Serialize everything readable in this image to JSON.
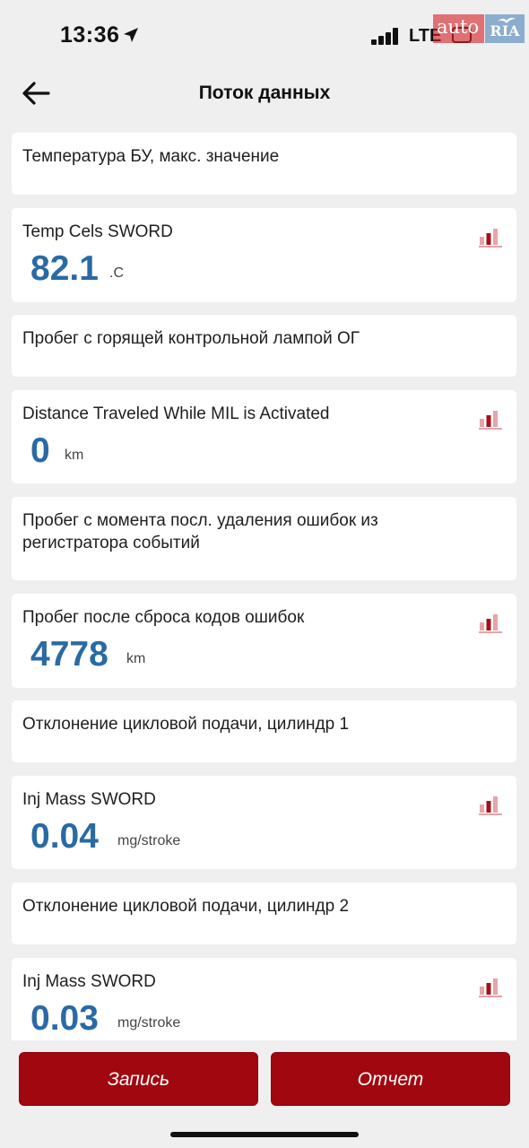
{
  "status_bar": {
    "time": "13:36",
    "network": "LTE",
    "watermark_left": "auto",
    "watermark_right": "RIA"
  },
  "header": {
    "title": "Поток данных",
    "back_icon": "arrow-left-icon"
  },
  "list": {
    "items": [
      {
        "type": "section",
        "title": "Температура БУ, макс. значение"
      },
      {
        "type": "param",
        "title": "Temp Cels SWORD",
        "value": "82.1",
        "unit": ".C",
        "icon": "graph-icon"
      },
      {
        "type": "section",
        "title": "Пробег с горящей контрольной лампой ОГ"
      },
      {
        "type": "param",
        "title": "Distance Traveled While MIL is Activated",
        "value": "0",
        "unit": "km",
        "icon": "graph-icon"
      },
      {
        "type": "section",
        "title": "Пробег с момента посл. удаления ошибок из регистратора событий"
      },
      {
        "type": "param",
        "title": "Пробег после сброса кодов ошибок",
        "value": "4778",
        "unit": "km",
        "icon": "graph-icon"
      },
      {
        "type": "section",
        "title": "Отклонение цикловой подачи, цилиндр 1"
      },
      {
        "type": "param",
        "title": "Inj Mass SWORD",
        "value": "0.04",
        "unit": "mg/stroke",
        "icon": "graph-icon"
      },
      {
        "type": "section",
        "title": "Отклонение цикловой подачи, цилиндр 2"
      },
      {
        "type": "param",
        "title": "Inj Mass SWORD",
        "value": "0.03",
        "unit": "mg/stroke",
        "icon": "graph-icon"
      }
    ]
  },
  "footer": {
    "record_label": "Запись",
    "report_label": "Отчет"
  },
  "colors": {
    "accent": "#a1070f",
    "value": "#2a6aa4",
    "background": "#efefef",
    "card": "#ffffff"
  }
}
